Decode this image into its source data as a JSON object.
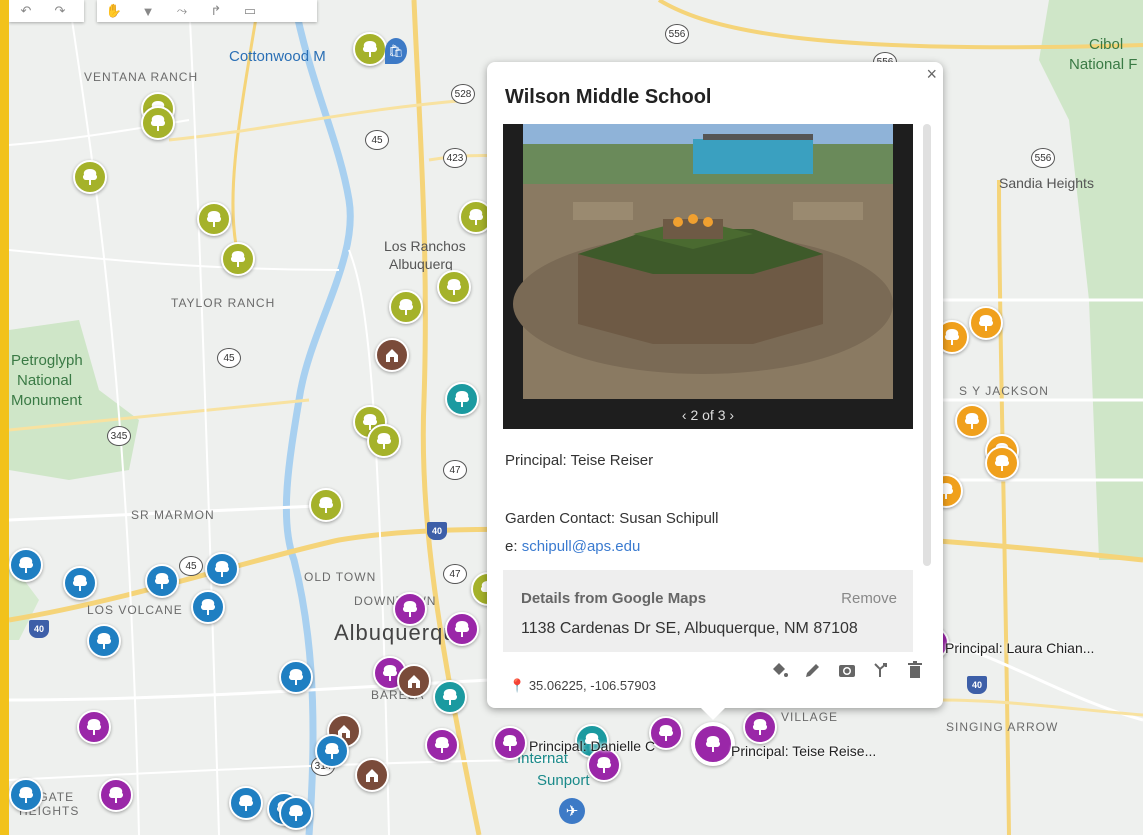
{
  "map": {
    "place_labels": [
      {
        "text": "VENTANA RANCH",
        "cls": ""
      },
      {
        "text": "Cottonwood M",
        "cls": "blue"
      },
      {
        "text": "Cibol",
        "cls": "green"
      },
      {
        "text": "National F",
        "cls": "green"
      },
      {
        "text": "Sandia Heights",
        "cls": "dark"
      },
      {
        "text": "Los Ranchos",
        "cls": "dark"
      },
      {
        "text": "Albuquerq",
        "cls": "dark"
      },
      {
        "text": "TAYLOR RANCH",
        "cls": ""
      },
      {
        "text": "Petroglyph",
        "cls": "green"
      },
      {
        "text": "National",
        "cls": "green"
      },
      {
        "text": "Monument",
        "cls": "green"
      },
      {
        "text": "S Y JACKSON",
        "cls": ""
      },
      {
        "text": "SR MARMON",
        "cls": ""
      },
      {
        "text": "OLD TOWN",
        "cls": ""
      },
      {
        "text": "DOWNTOWN",
        "cls": ""
      },
      {
        "text": "LOS VOLCANE",
        "cls": ""
      },
      {
        "text": "Albuquerque",
        "cls": "big"
      },
      {
        "text": "BARELA",
        "cls": ""
      },
      {
        "text": "VILLAGE",
        "cls": ""
      },
      {
        "text": "SINGING ARROW",
        "cls": ""
      },
      {
        "text": "STGATE",
        "cls": ""
      },
      {
        "text": "HEIGHTS",
        "cls": ""
      },
      {
        "text": "Internat",
        "cls": "teal"
      },
      {
        "text": "Sunport",
        "cls": "teal"
      }
    ],
    "route_shields": [
      "556",
      "556",
      "528",
      "45",
      "423",
      "556",
      "45",
      "345",
      "47",
      "40",
      "47",
      "45",
      "40",
      "40",
      "314"
    ],
    "marker_labels": [
      "Principal: Laura Chian...",
      "Principal: Danielle C",
      "Principal: Teise Reise..."
    ],
    "colors": {
      "olive": "#a5b22a",
      "brown": "#7a4b3a",
      "blue": "#1f7fc2",
      "purple": "#9a27a8",
      "orange": "#f0a01c",
      "teal": "#1b9aa0"
    }
  },
  "toolbar": {
    "icons": [
      "undo-icon",
      "redo-icon",
      "select-icon",
      "marker-icon",
      "draw-line-icon",
      "directions-icon",
      "ruler-icon"
    ]
  },
  "popup": {
    "title": "Wilson Middle School",
    "pager": "‹ 2 of 3 ›",
    "principal": "Principal: Teise Reiser",
    "garden_contact": "Garden Contact: Susan Schipull",
    "email_prefix": "e: ",
    "email": "schipull@aps.edu",
    "gm_header": "Details from Google Maps",
    "gm_remove": "Remove",
    "gm_address": "1138 Cardenas Dr SE, Albuquerque, NM 87108",
    "coords": "35.06225, -106.57903",
    "close": "×"
  }
}
